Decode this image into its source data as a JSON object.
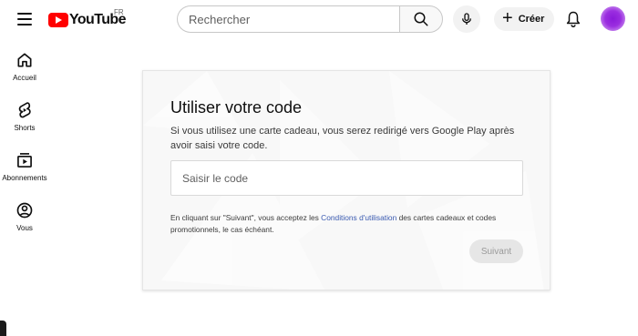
{
  "masthead": {
    "logo_text": "YouTube",
    "country_code": "FR",
    "search_placeholder": "Rechercher",
    "create_label": "Créer"
  },
  "guide": {
    "items": [
      {
        "label": "Accueil",
        "icon": "home-icon"
      },
      {
        "label": "Shorts",
        "icon": "shorts-icon"
      },
      {
        "label": "Abonnements",
        "icon": "subscriptions-icon"
      },
      {
        "label": "Vous",
        "icon": "account-icon"
      }
    ]
  },
  "redeem": {
    "title": "Utiliser votre code",
    "description": "Si vous utilisez une carte cadeau, vous serez redirigé vers Google Play après avoir saisi votre code.",
    "code_placeholder": "Saisir le code",
    "legal_prefix": "En cliquant sur \"Suivant\", vous acceptez les ",
    "legal_link": "Conditions d'utilisation",
    "legal_suffix": " des cartes cadeaux et codes promotionnels, le cas échéant.",
    "next_label": "Suivant"
  },
  "colors": {
    "brand_red": "#ff0000",
    "link_blue": "#3a5ab0",
    "avatar_purple": "#8a1ad9"
  }
}
